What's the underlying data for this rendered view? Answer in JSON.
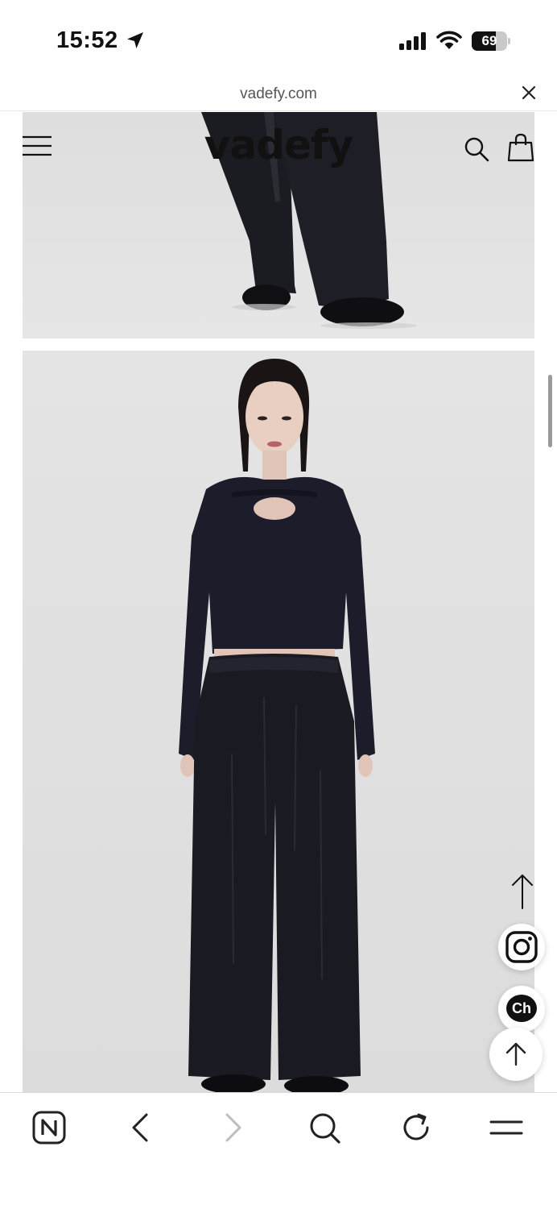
{
  "status_bar": {
    "time": "15:52",
    "battery_level": 69,
    "battery_text": "69",
    "icons": [
      "location-arrow-icon",
      "signal-bars-icon",
      "wifi-icon",
      "battery-icon"
    ]
  },
  "browser": {
    "url": "vadefy.com",
    "close_icon": "close-icon"
  },
  "site": {
    "logo": "vadefy",
    "menu_icon": "hamburger-menu-icon",
    "search_icon": "search-icon",
    "cart_icon": "shopping-bag-icon"
  },
  "content": {
    "photos": [
      {
        "name": "product-photo-pants-shoes",
        "desc_icon": "product-image"
      },
      {
        "name": "product-photo-model-full",
        "desc_icon": "product-image"
      }
    ]
  },
  "floating_buttons": {
    "scroll_up_icon": "arrow-up-icon",
    "instagram_icon": "instagram-icon",
    "channel_label": "Ch",
    "back_to_top_icon": "arrow-up-icon"
  },
  "toolbar": {
    "items": [
      "naver-icon",
      "back-chevron-icon",
      "forward-chevron-icon",
      "search-icon",
      "reload-icon",
      "menu-icon"
    ]
  },
  "colors": {
    "background": "#ffffff",
    "photo_bg": "#e3e3e3",
    "text_dark": "#111111",
    "url_text": "#555555",
    "garment": "#1c1c24"
  }
}
